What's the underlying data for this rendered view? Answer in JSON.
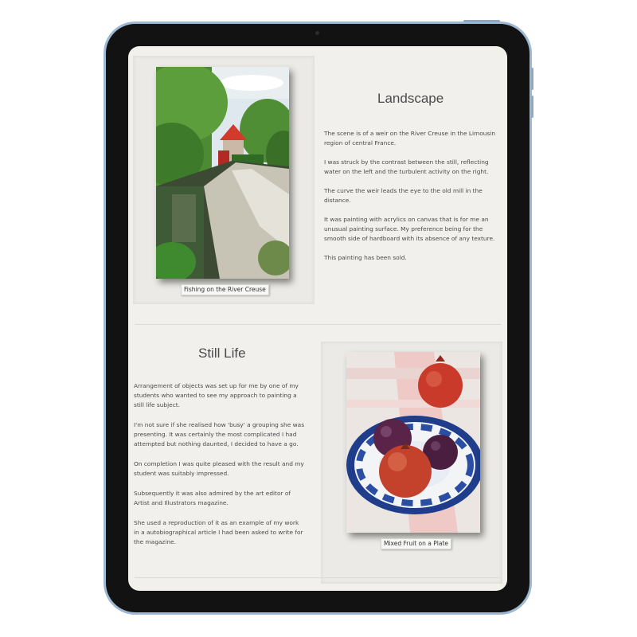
{
  "landscape": {
    "title": "Landscape",
    "caption": "Fishing on the River Creuse",
    "paragraphs": [
      "The scene is of a weir on the River Creuse in the Limousin region of central France.",
      "I was struck by the contrast between the still, reflecting water on the left and the turbulent activity on the right.",
      "The curve the weir leads the eye to the old mill in the distance.",
      "It was painting with acrylics on canvas that is for me an unusual painting surface. My preference being for the smooth side of hardboard with its absence of any texture.",
      "This painting has been sold."
    ]
  },
  "still_life": {
    "title": "Still Life",
    "caption": "Mixed Fruit on a Plate",
    "paragraphs": [
      "Arrangement of objects was set up for me by one of my students who wanted to see my approach to painting a still life subject.",
      "I'm not sure if she realised how 'busy' a grouping she was presenting. It was certainly the most complicated I had attempted but nothing daunted, I decided to have a go.",
      "On completion I was quite pleased with the result and my student was suitably impressed.",
      "Subsequently it was also admired by the art editor of Artist and Illustrators magazine.",
      "She used a reproduction of it as an example of my work in a autobiographical article I had been asked to write for the magazine."
    ]
  },
  "colors": {
    "device_frame": "#9db8d2",
    "bezel": "#121212",
    "page_bg": "#f1f0ed",
    "text": "#4a4a4a"
  }
}
